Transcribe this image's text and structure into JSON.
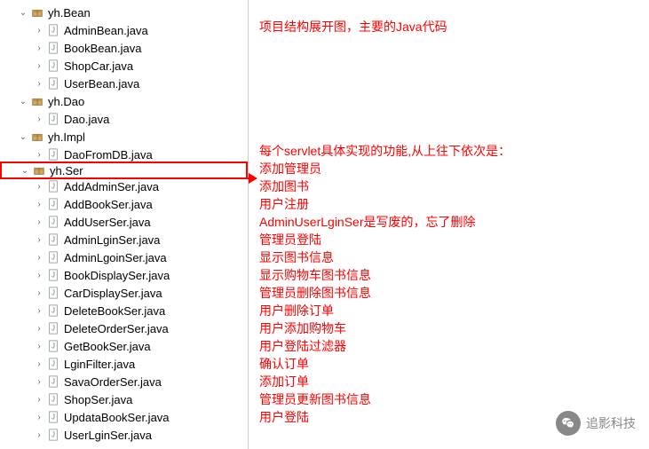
{
  "tree": {
    "packages": [
      {
        "name": "yh.Bean",
        "expanded": true,
        "children": [
          {
            "name": "AdminBean.java"
          },
          {
            "name": "BookBean.java"
          },
          {
            "name": "ShopCar.java"
          },
          {
            "name": "UserBean.java"
          }
        ]
      },
      {
        "name": "yh.Dao",
        "expanded": true,
        "children": [
          {
            "name": "Dao.java"
          }
        ]
      },
      {
        "name": "yh.Impl",
        "expanded": true,
        "children": [
          {
            "name": "DaoFromDB.java"
          }
        ]
      },
      {
        "name": "yh.Ser",
        "expanded": true,
        "highlighted": true,
        "children": [
          {
            "name": "AddAdminSer.java"
          },
          {
            "name": "AddBookSer.java"
          },
          {
            "name": "AddUserSer.java"
          },
          {
            "name": "AdminLginSer.java"
          },
          {
            "name": "AdminLgoinSer.java"
          },
          {
            "name": "BookDisplaySer.java"
          },
          {
            "name": "CarDisplaySer.java"
          },
          {
            "name": "DeleteBookSer.java"
          },
          {
            "name": "DeleteOrderSer.java"
          },
          {
            "name": "GetBookSer.java"
          },
          {
            "name": "LginFilter.java"
          },
          {
            "name": "SavaOrderSer.java"
          },
          {
            "name": "ShopSer.java"
          },
          {
            "name": "UpdataBookSer.java"
          },
          {
            "name": "UserLginSer.java"
          }
        ]
      }
    ]
  },
  "comments": {
    "top": "项目结构展开图，主要的Java代码",
    "servlet_header": "每个servlet具体实现的功能,从上往下依次是：",
    "lines": [
      "添加管理员",
      "添加图书",
      "用户注册",
      "AdminUserLginSer是写废的，忘了删除",
      "管理员登陆",
      "显示图书信息",
      "显示购物车图书信息",
      "管理员删除图书信息",
      "用户删除订单",
      "用户添加购物车",
      "用户登陆过滤器",
      "确认订单",
      "添加订单",
      "管理员更新图书信息",
      "用户登陆"
    ]
  },
  "watermark": "追影科技"
}
